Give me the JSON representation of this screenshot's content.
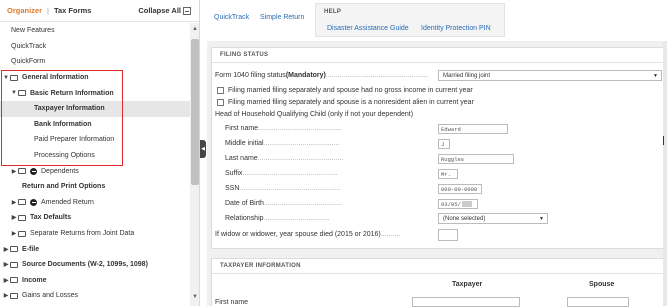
{
  "left": {
    "tab_organizer": "Organizer",
    "tab_sep": "|",
    "tab_taxforms": "Tax Forms",
    "collapse_all": "Collapse All",
    "items": [
      {
        "label": "New Features"
      },
      {
        "label": "QuickTrack"
      },
      {
        "label": "QuickForm"
      },
      {
        "label": "General Information"
      },
      {
        "label": "Basic Return Information"
      },
      {
        "label": "Taxpayer Information"
      },
      {
        "label": "Bank Information"
      },
      {
        "label": "Paid Preparer Information"
      },
      {
        "label": "Processing Options"
      },
      {
        "label": "Dependents"
      },
      {
        "label": "Return and Print Options"
      },
      {
        "label": "Amended Return"
      },
      {
        "label": "Tax Defaults"
      },
      {
        "label": "Separate Returns from Joint Data"
      },
      {
        "label": "E-file"
      },
      {
        "label": "Source Documents (W-2, 1099s, 1098)"
      },
      {
        "label": "Income"
      },
      {
        "label": "Gains and Losses"
      }
    ]
  },
  "topnav": {
    "quicktrack": "QuickTrack",
    "simple_return": "Simple Return",
    "help_title": "HELP",
    "disaster_guide": "Disaster Assistance Guide",
    "identity_pin": "Identity Protection PIN"
  },
  "filing": {
    "title": "FILING STATUS",
    "status_label": "Form 1040 filing status ",
    "status_mandatory": "(Mandatory)",
    "status_value": "Married filing joint",
    "cb1": "Filing married filing separately and spouse had no gross income in current year",
    "cb2": "Filing married filing separately and spouse is a nonresident alien in current year",
    "hoh": "Head of Household Qualifying Child (only if not your dependent)",
    "first_name_label": "First name",
    "first_name": "Edward",
    "middle_label": "Middle initial",
    "middle": "J",
    "last_label": "Last name",
    "last": "Ruggles",
    "suffix_label": "Suffix",
    "suffix": "Mr.",
    "ssn_label": "SSN",
    "ssn": "000-00-0000",
    "dob_label": "Date of Birth",
    "dob": "03/05/",
    "relationship_label": "Relationship",
    "relationship": "(None selected)",
    "widow_label": "If widow or widower, year spouse died (2015 or 2016)"
  },
  "taxpayer": {
    "title": "TAXPAYER INFORMATION",
    "col_taxpayer": "Taxpayer",
    "col_spouse": "Spouse",
    "first_name_label": "First name"
  },
  "colors": {
    "accent_orange": "#e07a2a",
    "link_blue": "#2a6db5",
    "highlight_red": "#e02b2b"
  }
}
